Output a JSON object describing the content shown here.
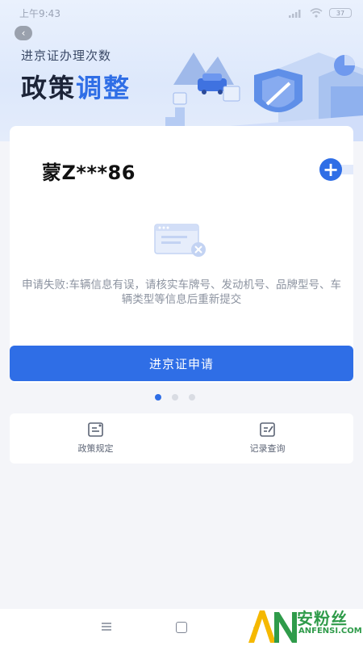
{
  "status_bar": {
    "time": "上午9:43",
    "battery": "37"
  },
  "banner": {
    "subtitle": "进京证办理次数",
    "title_main": "政策",
    "title_accent": "调整"
  },
  "vehicle": {
    "plate": "蒙Z***86"
  },
  "message": {
    "fail_text": "申请失败:车辆信息有误，请核实车牌号、发动机号、品牌型号、车辆类型等信息后重新提交"
  },
  "actions": {
    "apply_label": "进京证申请"
  },
  "pager": {
    "count": 3,
    "active_index": 0
  },
  "shortcuts": [
    {
      "label": "政策规定",
      "icon": "document-icon"
    },
    {
      "label": "记录查询",
      "icon": "edit-record-icon"
    }
  ],
  "watermark": {
    "logo_text": "AN",
    "cn": "安粉丝",
    "en": "ANFENSI.COM"
  },
  "colors": {
    "accent": "#2f6ee6",
    "background": "#f4f5f9",
    "fail_text": "#8c93a0",
    "watermark_green": "#2f9b4a"
  }
}
